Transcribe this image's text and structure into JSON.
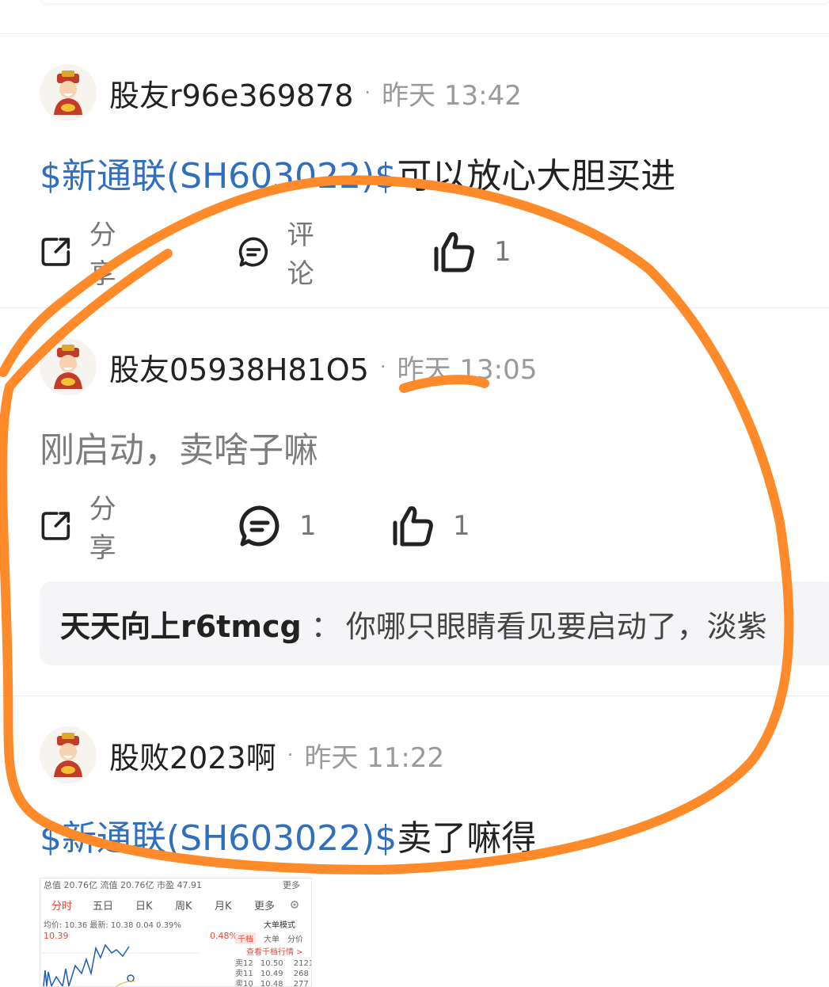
{
  "posts": [
    {
      "username": "股友r96e369878",
      "time": "昨天 13:42",
      "stock_tag": "$新通联(SH603022)$",
      "text": "可以放心大胆买进",
      "share_label": "分享",
      "comment_label": "评论",
      "like_count": "1"
    },
    {
      "username": "股友05938H81O5",
      "time": "昨天 13:05",
      "text": "刚启动，卖啥子嘛",
      "share_label": "分享",
      "comment_count": "1",
      "like_count": "1",
      "reply": {
        "username": "天天向上r6tmcg",
        "colon": "：",
        "text": "你哪只眼睛看见要启动了，淡紫"
      }
    },
    {
      "username": "股败2023啊",
      "time": "昨天 11:22",
      "stock_tag": "$新通联(SH603022)$",
      "text": "卖了嘛得",
      "thumbnail": {
        "stats_row": "总值 20.76亿  流值  20.76亿  市盈  47.91",
        "more": "更多",
        "tabs": [
          "分时",
          "五日",
          "日K",
          "周K",
          "月K",
          "更多"
        ],
        "price_row": "均价: 10.36 最新: 10.38 0.04 0.39%",
        "mode_label": "大单模式",
        "price_high": "10.39",
        "pct_high": "0.48%",
        "buttons": [
          "千档",
          "大单",
          "分价"
        ],
        "view_more": "查看千档行情 >",
        "order_rows": [
          {
            "label": "卖12",
            "price": "10.50",
            "vol": "2121"
          },
          {
            "label": "卖11",
            "price": "10.49",
            "vol": "268"
          },
          {
            "label": "卖10",
            "price": "10.48",
            "vol": "277"
          }
        ]
      }
    }
  ],
  "colors": {
    "stock_link": "#2f6fbd",
    "annotation": "#ff8a2a",
    "muted_text": "#9a9a9a"
  }
}
